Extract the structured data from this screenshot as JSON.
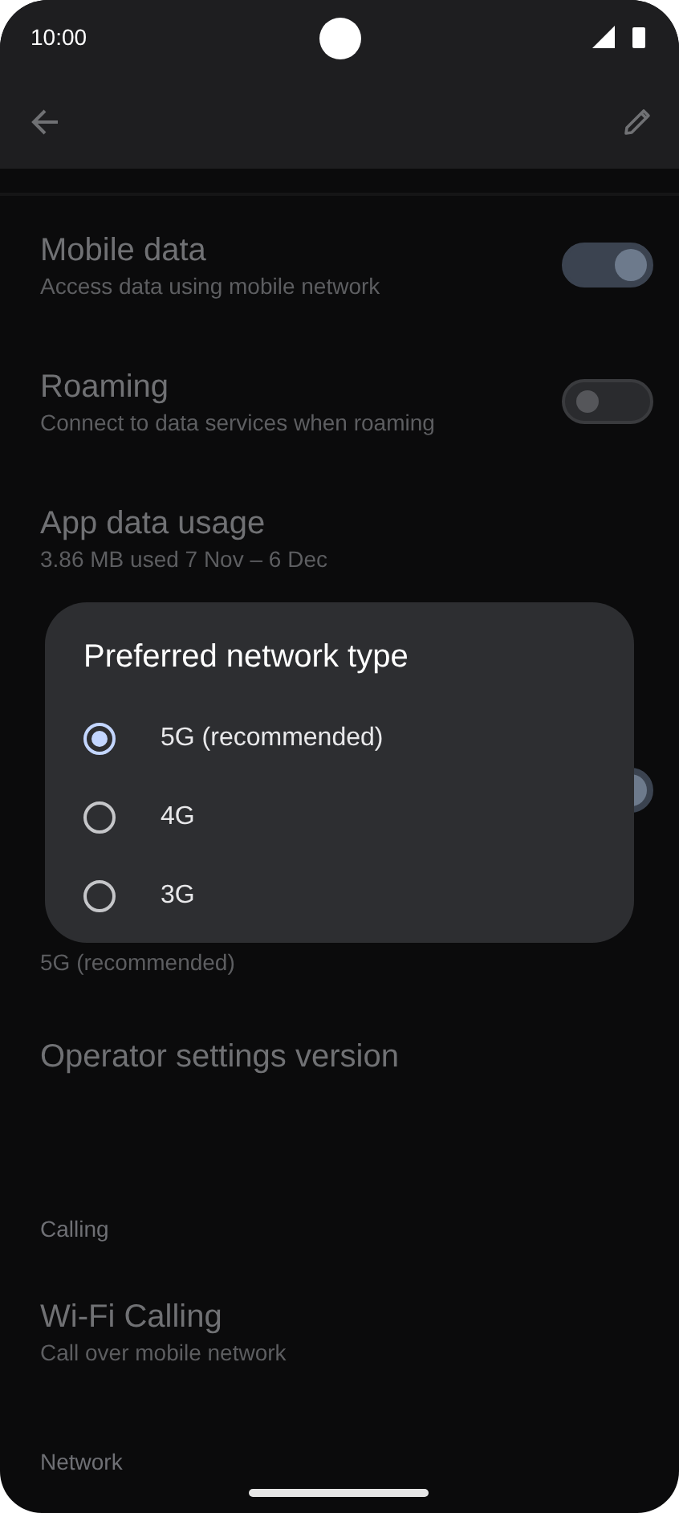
{
  "status_bar": {
    "time": "10:00"
  },
  "rows": [
    {
      "kind": "toggle",
      "title": "Mobile data",
      "subtitle": [
        "Access data using mobile network"
      ],
      "on": true
    },
    {
      "kind": "toggle",
      "title": "Roaming",
      "subtitle": [
        "Connect to data services when roaming"
      ],
      "on": false
    },
    {
      "kind": "text",
      "title": "App data usage",
      "subtitle": [
        "3.86 MB used 7 Nov – 6 Dec"
      ]
    },
    {
      "kind": "hidden"
    },
    {
      "kind": "covered_toggle",
      "on": true
    },
    {
      "kind": "covered_text",
      "subtitle": [
        "5G (recommended)"
      ]
    },
    {
      "kind": "tall",
      "title": "Operator settings version"
    },
    {
      "kind": "header",
      "title": "Calling"
    },
    {
      "kind": "text",
      "title": "Wi-Fi Calling",
      "subtitle": [
        "Call over mobile network"
      ]
    },
    {
      "kind": "header",
      "title": "Network"
    }
  ],
  "dialog": {
    "title": "Preferred network type",
    "options": [
      {
        "label": "5G (recommended)",
        "selected": true
      },
      {
        "label": "4G",
        "selected": false
      },
      {
        "label": "3G",
        "selected": false
      }
    ]
  }
}
